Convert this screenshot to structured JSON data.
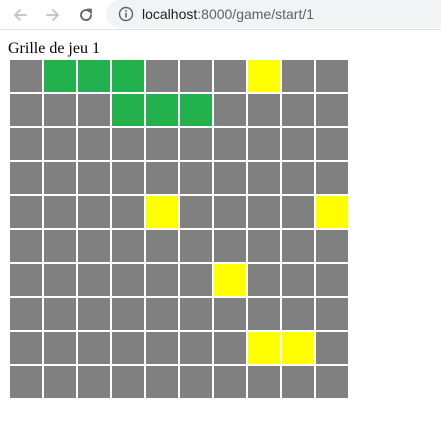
{
  "browser": {
    "url_host": "localhost",
    "url_rest": ":8000/game/start/1"
  },
  "page": {
    "title": "Grille de jeu 1"
  },
  "colors": {
    "empty": "#808080",
    "green": "#22b14c",
    "yellow": "#ffff00"
  },
  "grid": {
    "rows": 10,
    "cols": 10,
    "cells": [
      [
        "empty",
        "green",
        "green",
        "green",
        "empty",
        "empty",
        "empty",
        "yellow",
        "empty",
        "empty"
      ],
      [
        "empty",
        "empty",
        "empty",
        "green",
        "green",
        "green",
        "empty",
        "empty",
        "empty",
        "empty"
      ],
      [
        "empty",
        "empty",
        "empty",
        "empty",
        "empty",
        "empty",
        "empty",
        "empty",
        "empty",
        "empty"
      ],
      [
        "empty",
        "empty",
        "empty",
        "empty",
        "empty",
        "empty",
        "empty",
        "empty",
        "empty",
        "empty"
      ],
      [
        "empty",
        "empty",
        "empty",
        "empty",
        "yellow",
        "empty",
        "empty",
        "empty",
        "empty",
        "yellow"
      ],
      [
        "empty",
        "empty",
        "empty",
        "empty",
        "empty",
        "empty",
        "empty",
        "empty",
        "empty",
        "empty"
      ],
      [
        "empty",
        "empty",
        "empty",
        "empty",
        "empty",
        "empty",
        "yellow",
        "empty",
        "empty",
        "empty"
      ],
      [
        "empty",
        "empty",
        "empty",
        "empty",
        "empty",
        "empty",
        "empty",
        "empty",
        "empty",
        "empty"
      ],
      [
        "empty",
        "empty",
        "empty",
        "empty",
        "empty",
        "empty",
        "empty",
        "yellow",
        "yellow",
        "empty"
      ],
      [
        "empty",
        "empty",
        "empty",
        "empty",
        "empty",
        "empty",
        "empty",
        "empty",
        "empty",
        "empty"
      ]
    ]
  }
}
